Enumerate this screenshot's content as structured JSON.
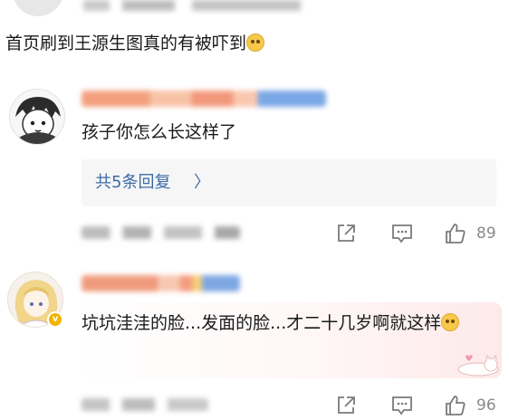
{
  "top_comment": {
    "text": "首页刷到王源生图真的有被吓到",
    "emoji_icon": "laughing-tears-emoji-icon"
  },
  "comments": [
    {
      "text": "孩子你怎么长这样了",
      "replies_label": "共5条回复",
      "replies_chevron": "〉",
      "like_count": "89"
    },
    {
      "text": "坑坑洼洼的脸...发面的脸...才二十几岁啊就这样",
      "emoji_icon": "confused-face-emoji-icon",
      "verified_badge": "v",
      "like_count": "96"
    }
  ],
  "colors": {
    "link_blue": "#3b6ba5",
    "meta_gray": "#8a8a8a",
    "badge_gold": "#f1b400"
  }
}
